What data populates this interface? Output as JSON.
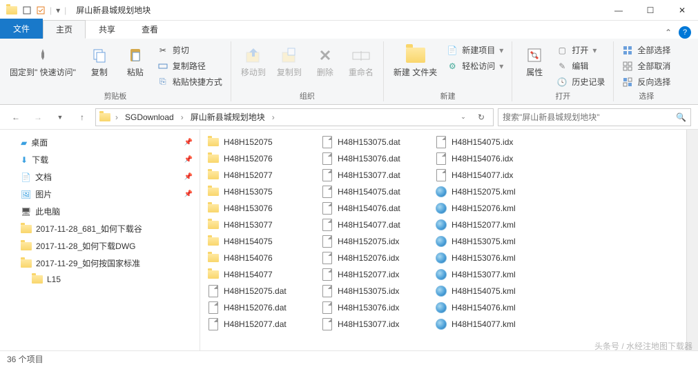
{
  "window": {
    "title": "屏山新县城规划地块",
    "min": "—",
    "max": "☐",
    "close": "✕"
  },
  "tabs": {
    "file": "文件",
    "home": "主页",
    "share": "共享",
    "view": "查看"
  },
  "ribbon": {
    "pin": "固定到\"\n快速访问\"",
    "copy": "复制",
    "paste": "粘贴",
    "cut": "剪切",
    "copypath": "复制路径",
    "pasteshortcut": "粘贴快捷方式",
    "clipboard": "剪贴板",
    "moveto": "移动到",
    "copyto": "复制到",
    "delete": "删除",
    "rename": "重命名",
    "organize": "组织",
    "newfolder": "新建\n文件夹",
    "newitem": "新建项目",
    "easyaccess": "轻松访问",
    "new": "新建",
    "properties": "属性",
    "open": "打开",
    "edit": "编辑",
    "history": "历史记录",
    "opengroup": "打开",
    "selectall": "全部选择",
    "selectnone": "全部取消",
    "invertsel": "反向选择",
    "select": "选择"
  },
  "breadcrumb": {
    "item1": "SGDownload",
    "item2": "屏山新县城规划地块"
  },
  "search": {
    "placeholder": "搜索\"屏山新县城规划地块\""
  },
  "nav": {
    "desktop": "桌面",
    "downloads": "下载",
    "documents": "文档",
    "pictures": "图片",
    "thispc": "此电脑",
    "f1": "2017-11-28_681_如何下载谷",
    "f2": "2017-11-28_如何下载DWG",
    "f3": "2017-11-29_如何按国家标准",
    "f4": "L15"
  },
  "files": {
    "bases": [
      "H48H152075",
      "H48H152076",
      "H48H152077",
      "H48H153075",
      "H48H153076",
      "H48H153077",
      "H48H154075",
      "H48H154076",
      "H48H154077"
    ]
  },
  "status": {
    "items": "36 个项目"
  },
  "watermark": "头条号 / 水经注地图下载器"
}
